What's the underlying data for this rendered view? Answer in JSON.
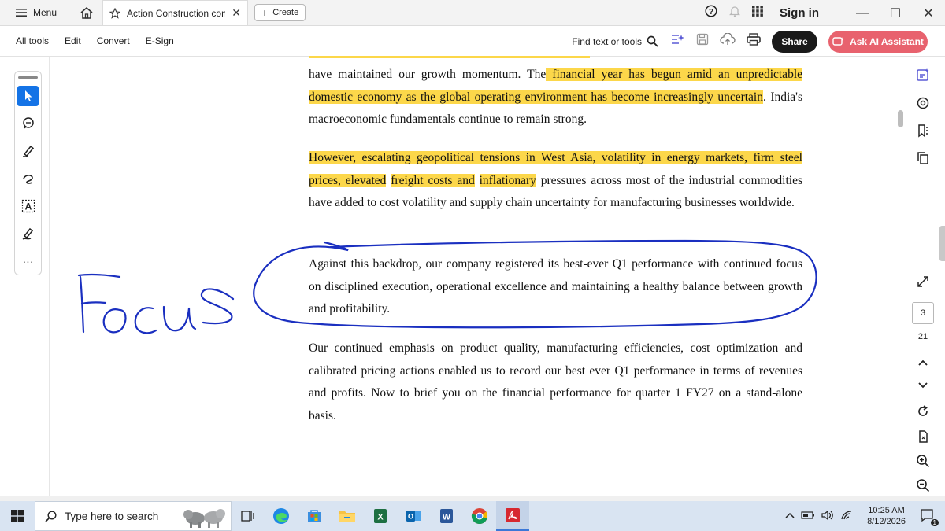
{
  "titlebar": {
    "menu_label": "Menu",
    "tab_title": "Action Construction conc...",
    "create_label": "Create",
    "signin_label": "Sign in"
  },
  "toolbar": {
    "all_tools": "All tools",
    "edit": "Edit",
    "convert": "Convert",
    "esign": "E-Sign",
    "find_label": "Find text or tools",
    "share_label": "Share",
    "ai_label": "Ask AI Assistant"
  },
  "document": {
    "p1_a": "have maintained our growth momentum. The",
    "p1_hl": " financial year has begun amid an unpredictable domestic economy as the global operating environment has become increasingly uncertain",
    "p1_b": ". India's macroeconomic fundamentals continue to remain strong.",
    "p2_hl1": "However, escalating geopolitical tensions in West Asia, volatility in energy markets, firm steel prices, elevated",
    "p2_sp1": " ",
    "p2_hl2": "freight costs and",
    "p2_sp2": " ",
    "p2_hl3": "inflationary",
    "p2_b": " pressures across most of the industrial commodities have added to cost volatility and supply chain uncertainty for manufacturing businesses worldwide.",
    "p3": "Against this backdrop, our company registered its best-ever Q1 performance with continued focus on disciplined execution, operational excellence and maintaining a healthy balance between growth and profitability.",
    "p4": "Our continued emphasis on product quality, manufacturing efficiencies, cost optimization and calibrated pricing actions enabled us to record our best ever Q1 performance in terms of revenues and profits. Now to brief you on the financial performance for quarter 1 FY27 on a stand-alone basis."
  },
  "annotation": {
    "handwritten_text": "FOCUS",
    "ink_color": "#1a2fc0"
  },
  "page_nav": {
    "current_page": "3",
    "total_pages": "21"
  },
  "taskbar": {
    "search_placeholder": "Type here to search",
    "time": "10:25 AM",
    "date": "8/12/2026",
    "notification_count": "1"
  },
  "colors": {
    "highlight": "#fcd74a",
    "accent_blue": "#1473e6",
    "ai_button": "#e8626e"
  }
}
